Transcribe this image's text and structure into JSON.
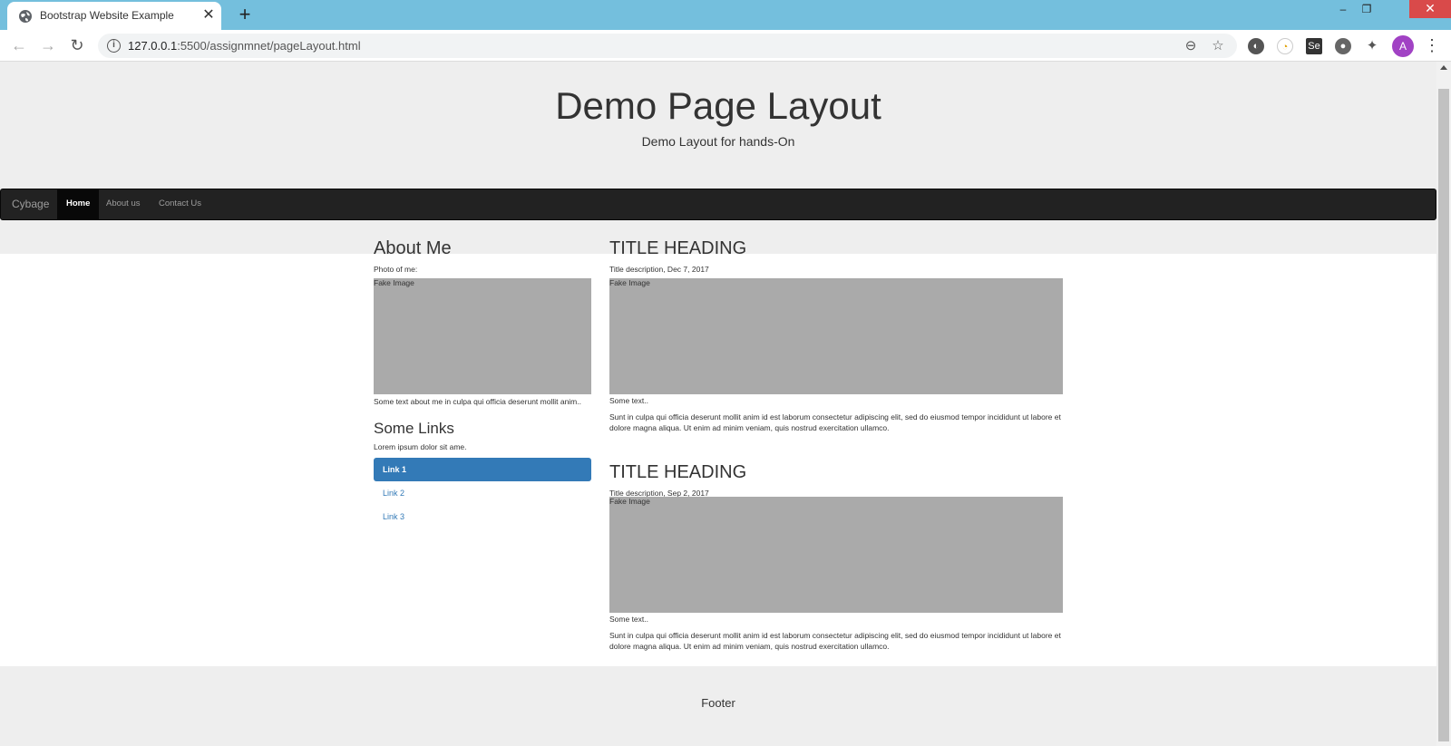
{
  "browser": {
    "tab_title": "Bootstrap Website Example",
    "tab_close": "✕",
    "new_tab": "+",
    "url_host": "127.0.0.1",
    "url_rest": ":5500/assignmnet/pageLayout.html",
    "avatar_letter": "A",
    "win_min": "–",
    "win_restore": "❐",
    "win_close": "✕",
    "accent_color": "#74bfdd"
  },
  "page": {
    "title": "Demo Page Layout",
    "subtitle": "Demo Layout for hands-On",
    "navbar": {
      "brand": "Cybage",
      "items": [
        {
          "label": "Home",
          "active": true
        },
        {
          "label": "About us",
          "active": false
        },
        {
          "label": "Contact Us",
          "active": false
        }
      ]
    },
    "sidebar": {
      "about_heading": "About Me",
      "photo_label": "Photo of me:",
      "fake_image": "Fake Image",
      "about_text": "Some text about me in culpa qui officia deserunt mollit anim..",
      "links_heading": "Some Links",
      "links_text": "Lorem ipsum dolor sit ame.",
      "links": [
        {
          "label": "Link 1",
          "active": true
        },
        {
          "label": "Link 2",
          "active": false
        },
        {
          "label": "Link 3",
          "active": false
        }
      ]
    },
    "posts": [
      {
        "heading": "TITLE HEADING",
        "description": "Title description, Dec 7, 2017",
        "fake_image": "Fake Image",
        "some_text": "Some text..",
        "body": "Sunt in culpa qui officia deserunt mollit anim id est laborum consectetur adipiscing elit, sed do eiusmod tempor incididunt ut labore et dolore magna aliqua. Ut enim ad minim veniam, quis nostrud exercitation ullamco."
      },
      {
        "heading": "TITLE HEADING",
        "description": "Title description, Sep 2, 2017",
        "fake_image": "Fake Image",
        "some_text": "Some text..",
        "body": "Sunt in culpa qui officia deserunt mollit anim id est laborum consectetur adipiscing elit, sed do eiusmod tempor incididunt ut labore et dolore magna aliqua. Ut enim ad minim veniam, quis nostrud exercitation ullamco."
      }
    ],
    "footer": "Footer"
  }
}
